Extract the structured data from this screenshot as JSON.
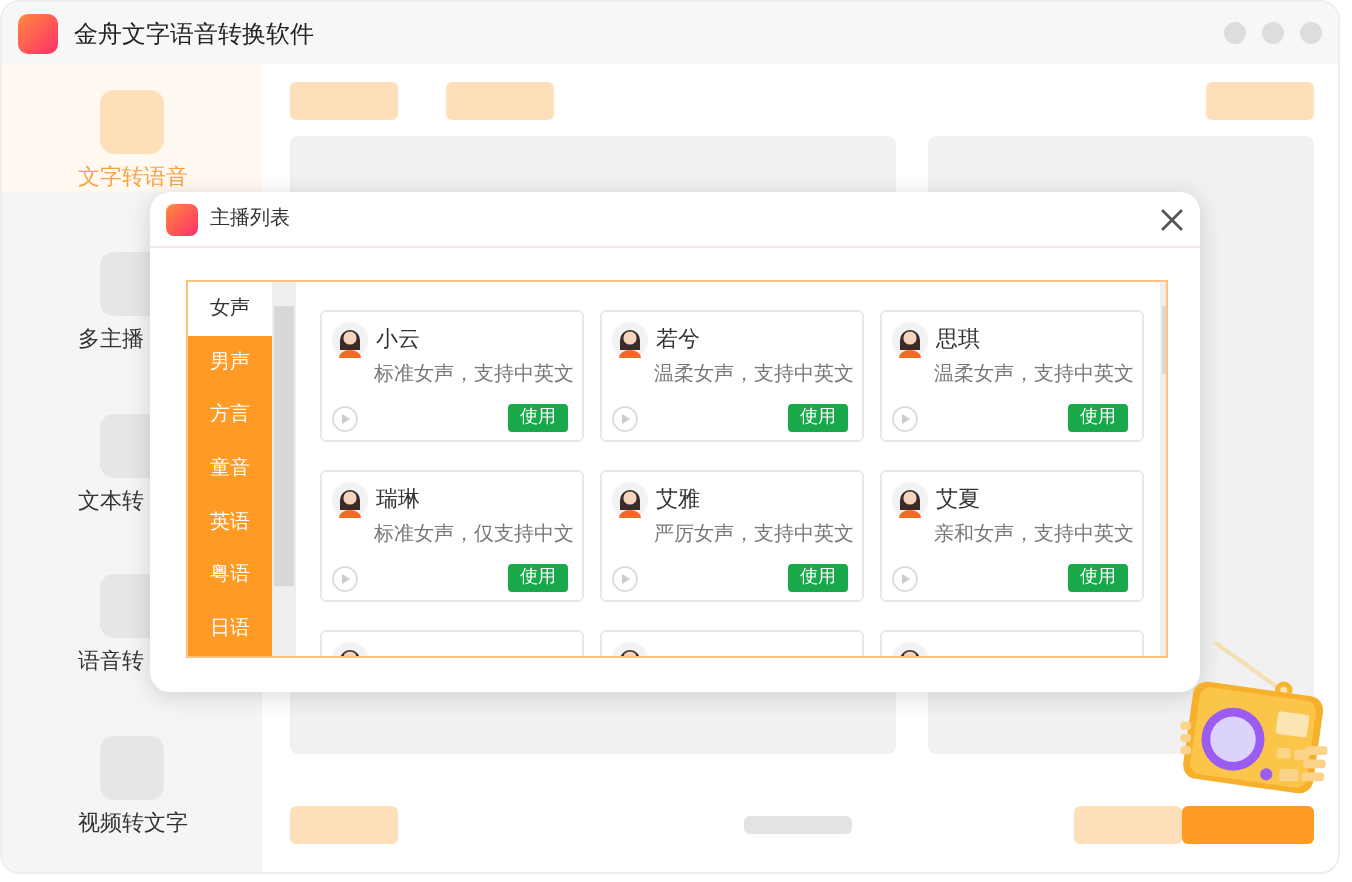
{
  "window": {
    "title": "金舟文字语音转换软件"
  },
  "sidebar": {
    "items": [
      {
        "label": "文字转语音",
        "selected": true
      },
      {
        "label": "多主播",
        "selected": false
      },
      {
        "label": "文本转",
        "selected": false
      },
      {
        "label": "语音转",
        "selected": false
      },
      {
        "label": "视频转文字",
        "selected": false
      }
    ]
  },
  "dialog": {
    "title": "主播列表",
    "categories": [
      {
        "label": "女声",
        "selected": true
      },
      {
        "label": "男声",
        "selected": false
      },
      {
        "label": "方言",
        "selected": false
      },
      {
        "label": "童音",
        "selected": false
      },
      {
        "label": "英语",
        "selected": false
      },
      {
        "label": "粤语",
        "selected": false
      },
      {
        "label": "日语",
        "selected": false
      }
    ],
    "voices": [
      {
        "kind": "full",
        "name": "小云",
        "description": "标准女声，支持中英文",
        "button": "使用"
      },
      {
        "kind": "full",
        "name": "若兮",
        "description": "温柔女声，支持中英文",
        "button": "使用"
      },
      {
        "kind": "full",
        "name": "思琪",
        "description": "温柔女声，支持中英文",
        "button": "使用"
      },
      {
        "kind": "full",
        "name": "瑞琳",
        "description": "标准女声，仅支持中文",
        "button": "使用"
      },
      {
        "kind": "full",
        "name": "艾雅",
        "description": "严厉女声，支持中英文",
        "button": "使用"
      },
      {
        "kind": "full",
        "name": "艾夏",
        "description": "亲和女声，支持中英文",
        "button": "使用"
      },
      {
        "kind": "cut"
      },
      {
        "kind": "cut"
      },
      {
        "kind": "cut"
      }
    ]
  }
}
